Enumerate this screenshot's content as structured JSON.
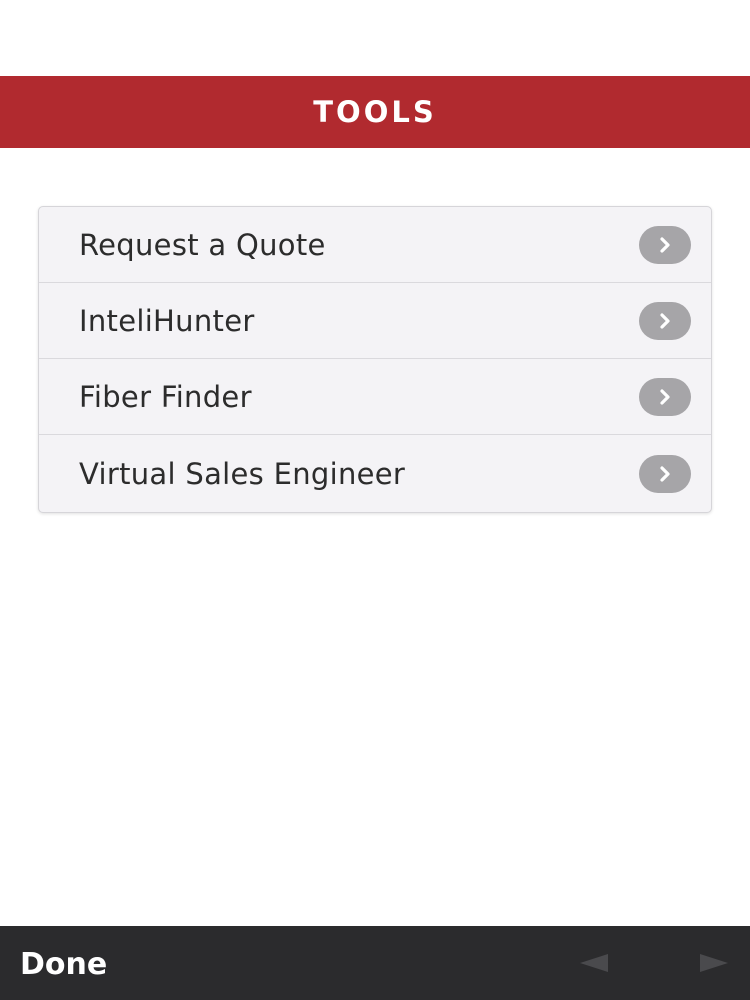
{
  "header": {
    "title": "TOOLS",
    "color": "#b12a2f"
  },
  "tools": [
    {
      "label": "Request a Quote",
      "icon": "chevron-right-icon"
    },
    {
      "label": "InteliHunter",
      "icon": "chevron-right-icon"
    },
    {
      "label": "Fiber Finder",
      "icon": "chevron-right-icon"
    },
    {
      "label": "Virtual Sales Engineer",
      "icon": "chevron-right-icon"
    }
  ],
  "toolbar": {
    "done_label": "Done",
    "back_icon": "back-arrow-icon",
    "forward_icon": "forward-arrow-icon"
  }
}
